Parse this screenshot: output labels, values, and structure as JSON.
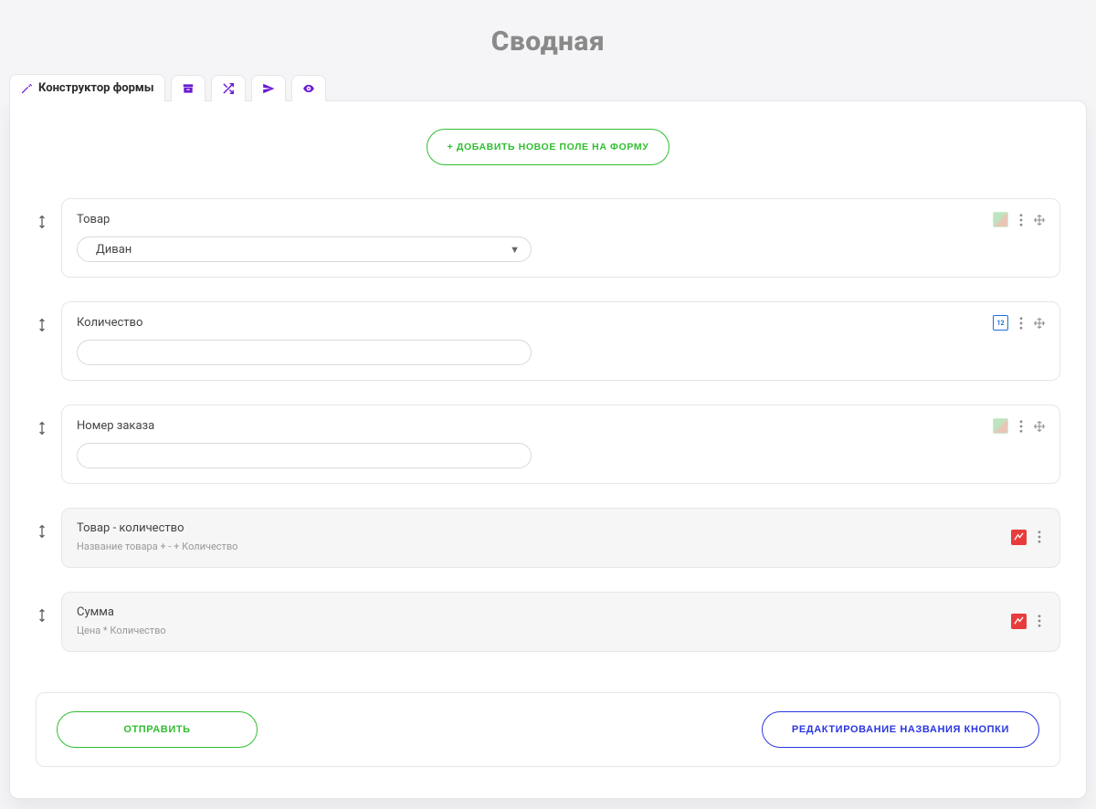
{
  "page": {
    "title": "Сводная"
  },
  "tabs": {
    "constructor": "Конструктор формы"
  },
  "buttons": {
    "add_field": "+ ДОБАВИТЬ НОВОЕ ПОЛЕ НА ФОРМУ",
    "submit": "ОТПРАВИТЬ",
    "edit_button_name": "РЕДАКТИРОВАНИЕ НАЗВАНИЯ КНОПКИ"
  },
  "fields": {
    "product": {
      "label": "Товар",
      "selected": "Диван",
      "type_badge": "catalog"
    },
    "quantity": {
      "label": "Количество",
      "value": "",
      "type_badge_text": "12"
    },
    "order_number": {
      "label": "Номер заказа",
      "value": "",
      "type_badge": "catalog"
    },
    "product_quantity": {
      "label": "Товар - количество",
      "formula": "Название товара + - + Количество"
    },
    "sum": {
      "label": "Сумма",
      "formula": "Цена * Количество"
    }
  }
}
